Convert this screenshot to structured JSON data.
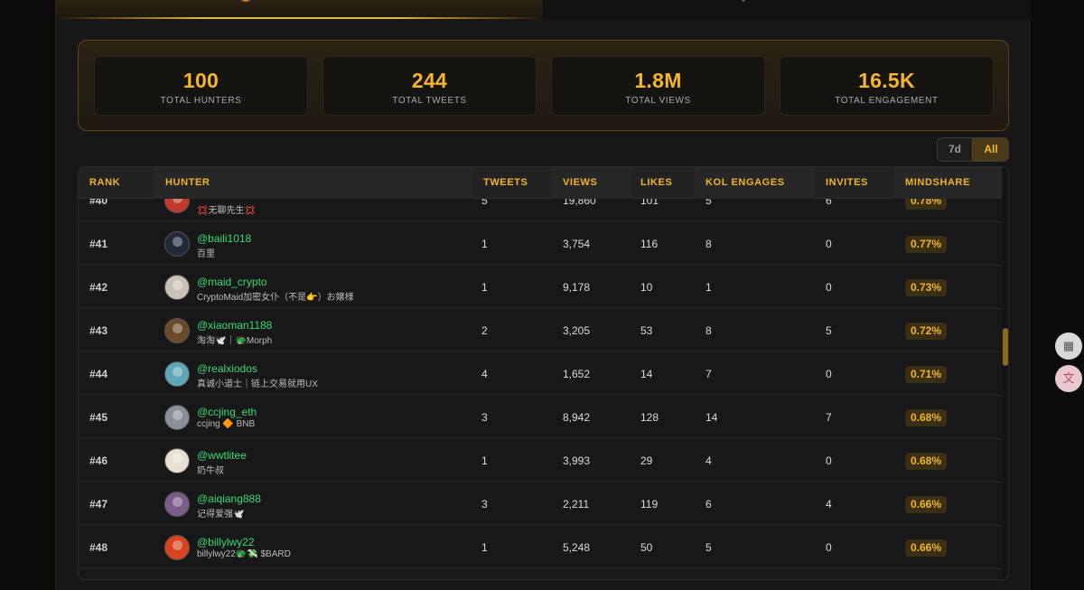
{
  "stats": [
    {
      "value": "100",
      "label": "TOTAL HUNTERS"
    },
    {
      "value": "244",
      "label": "TOTAL TWEETS"
    },
    {
      "value": "1.8M",
      "label": "TOTAL VIEWS"
    },
    {
      "value": "16.5K",
      "label": "TOTAL ENGAGEMENT"
    }
  ],
  "period": {
    "option_7d": "7d",
    "option_all": "All",
    "selected": "All"
  },
  "table": {
    "headers": {
      "rank": "RANK",
      "hunter": "HUNTER",
      "tweets": "TWEETS",
      "views": "VIEWS",
      "likes": "LIKES",
      "kol": "KOL ENGAGES",
      "invites": "INVITES",
      "mindshare": "MINDSHARE"
    },
    "rows": [
      {
        "rank": "#40",
        "handle": "",
        "display": "💢无聊先生💢",
        "tweets": "5",
        "views": "19,860",
        "likes": "101",
        "kol": "5",
        "invites": "6",
        "mindshare": "0.78%",
        "avatar_color": "#c0392b"
      },
      {
        "rank": "#41",
        "handle": "@baili1018",
        "display": "百里",
        "tweets": "1",
        "views": "3,754",
        "likes": "116",
        "kol": "8",
        "invites": "0",
        "mindshare": "0.77%",
        "avatar_color": "#1f2a3a"
      },
      {
        "rank": "#42",
        "handle": "@maid_crypto",
        "display": "CryptoMaid加密女仆（不是👉）お嬢様",
        "tweets": "1",
        "views": "9,178",
        "likes": "10",
        "kol": "1",
        "invites": "0",
        "mindshare": "0.73%",
        "avatar_color": "#c9c2b6"
      },
      {
        "rank": "#43",
        "handle": "@xiaoman1188",
        "display": "淘淘🕊️｜🐲Morph",
        "tweets": "2",
        "views": "3,205",
        "likes": "53",
        "kol": "8",
        "invites": "5",
        "mindshare": "0.72%",
        "avatar_color": "#6b4a2a"
      },
      {
        "rank": "#44",
        "handle": "@realxiodos",
        "display": "真诚小道士｜链上交易就用UX",
        "tweets": "4",
        "views": "1,652",
        "likes": "14",
        "kol": "7",
        "invites": "0",
        "mindshare": "0.71%",
        "avatar_color": "#5fa7b8"
      },
      {
        "rank": "#45",
        "handle": "@ccjing_eth",
        "display": "ccjing 🔶 BNB",
        "tweets": "3",
        "views": "8,942",
        "likes": "128",
        "kol": "14",
        "invites": "7",
        "mindshare": "0.68%",
        "avatar_color": "#8a8f98"
      },
      {
        "rank": "#46",
        "handle": "@wwtlitee",
        "display": "奶牛叔",
        "tweets": "1",
        "views": "3,993",
        "likes": "29",
        "kol": "4",
        "invites": "0",
        "mindshare": "0.68%",
        "avatar_color": "#e8e1d0"
      },
      {
        "rank": "#47",
        "handle": "@aiqiang888",
        "display": "记得爱强🕊️",
        "tweets": "3",
        "views": "2,211",
        "likes": "119",
        "kol": "6",
        "invites": "4",
        "mindshare": "0.66%",
        "avatar_color": "#7a5c8a"
      },
      {
        "rank": "#48",
        "handle": "@billylwy22",
        "display": "billylwy22🐲💸 $BARD",
        "tweets": "1",
        "views": "5,248",
        "likes": "50",
        "kol": "5",
        "invites": "0",
        "mindshare": "0.66%",
        "avatar_color": "#d8451d"
      }
    ]
  },
  "side_buttons": [
    {
      "icon": "grid-icon"
    },
    {
      "icon": "translate-icon"
    }
  ]
}
